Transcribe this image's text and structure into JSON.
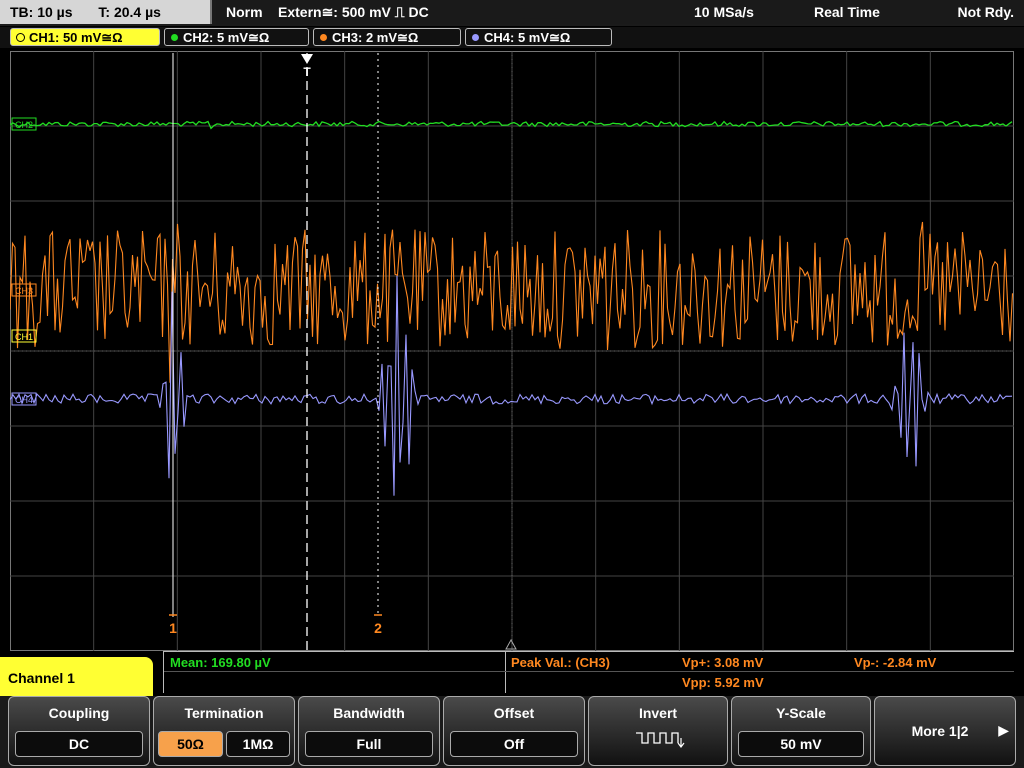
{
  "header": {
    "timebase": "TB: 10 µs",
    "trigger_time": "T: 20.4 µs",
    "mode": "Norm",
    "trigger_source": "Extern≅: 500 mV ⎍ DC",
    "sample_rate": "10 MSa/s",
    "acq_mode": "Real Time",
    "status": "Not Rdy."
  },
  "channels": [
    {
      "label": "CH1: 50 mV≅Ω",
      "color": "#ffff33",
      "active": true
    },
    {
      "label": "CH2: 5 mV≅Ω",
      "color": "#22dd22",
      "active": false
    },
    {
      "label": "CH3: 2 mV≅Ω",
      "color": "#ff8820",
      "active": false
    },
    {
      "label": "CH4: 5 mV≅Ω",
      "color": "#9999ff",
      "active": false
    }
  ],
  "markers": {
    "ch2": "CH2",
    "ch3": "CH3",
    "ch1": "CH1",
    "ch4": "CH4",
    "trigger": "T",
    "cursor1": "1",
    "cursor2": "2"
  },
  "measurements": {
    "mean": "Mean: 169.80 µV",
    "peak_label": "Peak Val.: (CH3)",
    "vp_plus": "Vp+: 3.08 mV",
    "vp_minus": "Vp-: -2.84 mV",
    "vpp": "Vpp: 5.92 mV"
  },
  "menu_title": "Channel 1",
  "softkeys": {
    "coupling": {
      "title": "Coupling",
      "value": "DC"
    },
    "termination": {
      "title": "Termination",
      "opt1": "50Ω",
      "opt2": "1MΩ"
    },
    "bandwidth": {
      "title": "Bandwidth",
      "value": "Full"
    },
    "offset": {
      "title": "Offset",
      "value": "Off"
    },
    "invert": {
      "title": "Invert"
    },
    "yscale": {
      "title": "Y-Scale",
      "value": "50 mV"
    },
    "more": {
      "title": "More 1|2"
    }
  },
  "colors": {
    "ch1": "#ffff33",
    "ch2": "#22dd22",
    "ch3": "#ff8820",
    "ch4": "#9999ff",
    "cursor": "#ff8820",
    "grid": "#4a4a4a"
  }
}
